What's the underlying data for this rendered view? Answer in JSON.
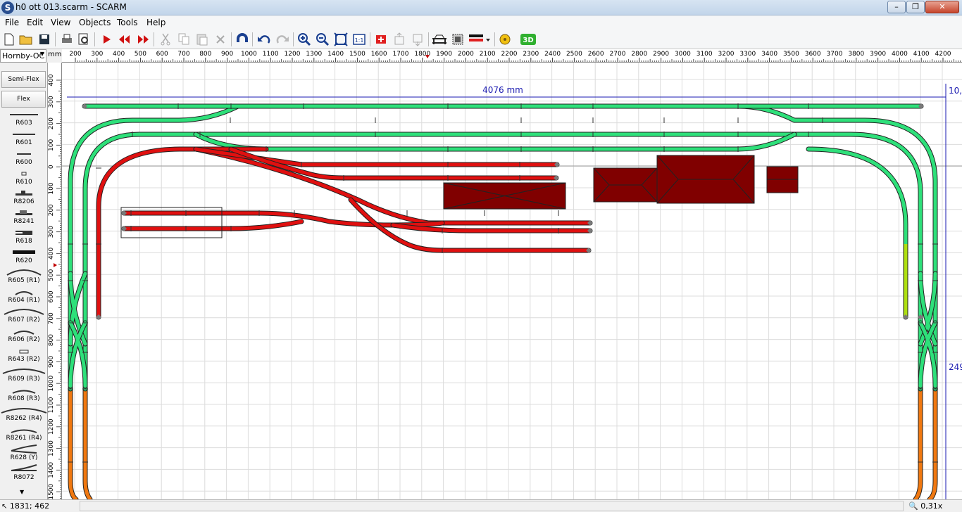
{
  "window": {
    "title": "h0 ott 013.scarm - SCARM",
    "app_icon": "S",
    "buttons": [
      "minimize",
      "maximize",
      "close"
    ]
  },
  "menu": [
    "File",
    "Edit",
    "View",
    "Objects",
    "Tools",
    "Help"
  ],
  "toolbar": {
    "icons": [
      "new-file-icon",
      "open-folder-icon",
      "save-icon",
      "print-icon",
      "print-preview-icon",
      "select-arrow-icon",
      "rotate-left-icon",
      "rotate-right-icon",
      "cut-icon",
      "copy-icon",
      "paste-icon",
      "delete-icon",
      "magnet-icon",
      "undo-icon",
      "redo-icon",
      "zoom-in-icon",
      "zoom-out-icon",
      "zoom-fit-icon",
      "zoom-1to1-icon",
      "layer-icon",
      "level-up-icon",
      "level-down-icon",
      "bridge-icon",
      "board-icon",
      "track-color-icon",
      "measure-icon"
    ],
    "view_3d_label": "3D",
    "zoom_1to1_label": "1:1"
  },
  "catalog": {
    "selected": "Hornby-OC"
  },
  "ruler": {
    "units": "mm",
    "h_labels": [
      "200",
      "300",
      "400",
      "500",
      "600",
      "700",
      "800",
      "900",
      "1000",
      "1100",
      "1200",
      "1300",
      "1400",
      "1500",
      "1600",
      "1700",
      "1800",
      "1900",
      "2000",
      "2100",
      "2200",
      "2300",
      "2400",
      "2500",
      "2600",
      "2700",
      "2800",
      "2900",
      "3000",
      "3100",
      "3200",
      "3300",
      "3400",
      "3500",
      "3600",
      "3700",
      "3800",
      "3900",
      "4000",
      "4100",
      "4200"
    ],
    "v_labels": [
      "400",
      "300",
      "200",
      "100",
      "0",
      "100",
      "200",
      "300",
      "400",
      "500",
      "600",
      "700",
      "800",
      "900",
      "1000",
      "1100",
      "1200",
      "1300",
      "1400",
      "1500"
    ]
  },
  "palette": {
    "buttons": [
      "Semi-Flex",
      "Flex"
    ],
    "items": [
      "R603",
      "R601",
      "R600",
      "R610",
      "R8206",
      "R8241",
      "R618",
      "R620",
      "R605 (R1)",
      "R604 (R1)",
      "R607 (R2)",
      "R606 (R2)",
      "R643 (R2)",
      "R609 (R3)",
      "R608 (R3)",
      "R8262 (R4)",
      "R8261 (R4)",
      "R628 (Y)",
      "R8072"
    ]
  },
  "canvas": {
    "dim_width": "4076 mm",
    "dim_height": "249",
    "dim_corner": "10,"
  },
  "colors": {
    "track_green": "#2ee07a",
    "track_red": "#e01010",
    "track_orange": "#f07810",
    "track_yellow_green": "#aee010",
    "building": "#800000",
    "dimension": "#1a1ab0"
  },
  "status": {
    "coords": "1831; 462",
    "zoom": "0,31x"
  }
}
